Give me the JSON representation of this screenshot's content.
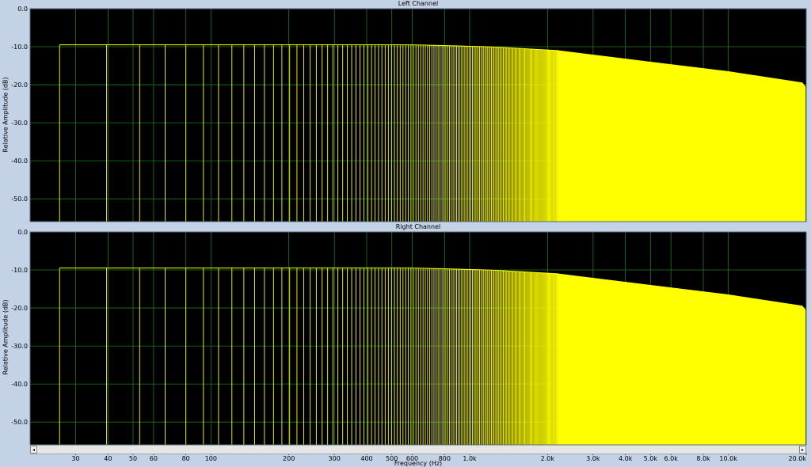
{
  "chart_data": [
    {
      "type": "bar",
      "title": "Left Channel",
      "ylabel": "Relative Amplitude (dB)",
      "xlabel": "Frequency (Hz)",
      "x_scale": "log",
      "xlim": [
        20,
        20000
      ],
      "ylim": [
        -56,
        0
      ],
      "yticks": [
        "0.0",
        "-10.0",
        "-20.0",
        "-30.0",
        "-40.0",
        "-50.0"
      ],
      "grid": true,
      "series": [
        {
          "color": "#ffff00",
          "line_start_hz": 26,
          "line_spacing_hz": 13.5,
          "dense_from_hz": 2200,
          "fill_until_hz": 19850,
          "level_db": [
            [
              26,
              -9.5
            ],
            [
              600,
              -9.5
            ],
            [
              1200,
              -10.0
            ],
            [
              2200,
              -11.0
            ],
            [
              5000,
              -14.0
            ],
            [
              10000,
              -16.5
            ],
            [
              19500,
              -19.5
            ],
            [
              19850,
              -20.5
            ]
          ]
        }
      ]
    },
    {
      "type": "bar",
      "title": "Right Channel",
      "ylabel": "Relative Amplitude (dB)",
      "xlabel": "Frequency (Hz)",
      "x_scale": "log",
      "xlim": [
        20,
        20000
      ],
      "ylim": [
        -56,
        0
      ],
      "yticks": [
        "0.0",
        "-10.0",
        "-20.0",
        "-30.0",
        "-40.0",
        "-50.0"
      ],
      "grid": true,
      "series": [
        {
          "color": "#ffff00",
          "line_start_hz": 26,
          "line_spacing_hz": 13.5,
          "dense_from_hz": 2200,
          "fill_until_hz": 19850,
          "level_db": [
            [
              26,
              -9.5
            ],
            [
              600,
              -9.5
            ],
            [
              1200,
              -10.0
            ],
            [
              2200,
              -11.0
            ],
            [
              5000,
              -14.0
            ],
            [
              10000,
              -16.5
            ],
            [
              19500,
              -19.5
            ],
            [
              19850,
              -20.5
            ]
          ]
        }
      ]
    }
  ],
  "x_axis": {
    "title": "Frequency (Hz)",
    "ticks": [
      {
        "hz": 30,
        "label": "30"
      },
      {
        "hz": 40,
        "label": "40"
      },
      {
        "hz": 50,
        "label": "50"
      },
      {
        "hz": 60,
        "label": "60"
      },
      {
        "hz": 80,
        "label": "80"
      },
      {
        "hz": 100,
        "label": "100"
      },
      {
        "hz": 200,
        "label": "200"
      },
      {
        "hz": 300,
        "label": "300"
      },
      {
        "hz": 400,
        "label": "400"
      },
      {
        "hz": 500,
        "label": "500"
      },
      {
        "hz": 600,
        "label": "600"
      },
      {
        "hz": 800,
        "label": "800"
      },
      {
        "hz": 1000,
        "label": "1.0k"
      },
      {
        "hz": 2000,
        "label": "2.0k"
      },
      {
        "hz": 3000,
        "label": "3.0k"
      },
      {
        "hz": 4000,
        "label": "4.0k"
      },
      {
        "hz": 5000,
        "label": "5.0k"
      },
      {
        "hz": 6000,
        "label": "6.0k"
      },
      {
        "hz": 8000,
        "label": "8.0k"
      },
      {
        "hz": 10000,
        "label": "10.0k"
      },
      {
        "hz": 20000,
        "label": "20.0k"
      }
    ]
  },
  "colors": {
    "plot_bg": "#000000",
    "grid": "#1f7a1f",
    "trace": "#ffff00",
    "frame_bg": "#c3d2e6"
  },
  "scrollbar": {
    "left": "◂",
    "right": "▸"
  },
  "toolbar": {
    "icons": [
      "zoom-icon",
      "peak-up-icon",
      "peak-down-icon"
    ],
    "glyphs": "⊕△▽"
  }
}
